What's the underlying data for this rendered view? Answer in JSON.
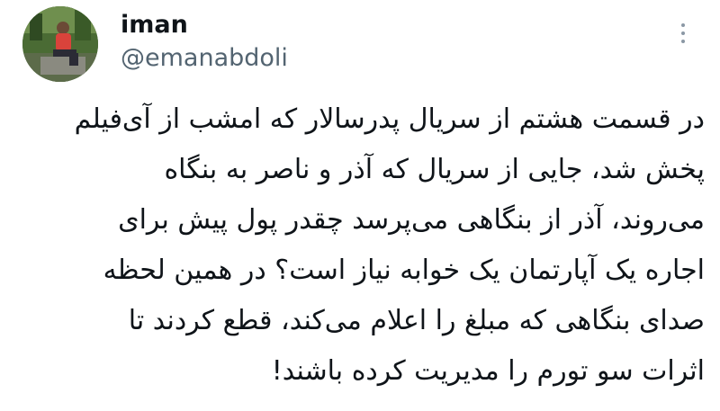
{
  "author": {
    "display_name": "iman",
    "handle": "@emanabdoli"
  },
  "icons": {
    "more": "more-options-icon",
    "avatar": "profile-photo"
  },
  "tweet": {
    "lines": [
      "در قسمت هشتم از سریال پدرسالار که امشب از آی‌فیلم",
      "پخش شد، جایی از سریال که آذر و ناصر  به بنگاه",
      "می‌روند، آذر از بنگاهی می‌پرسد چقدر پول پیش برای",
      "اجاره یک آپارتمان یک خوابه نیاز است؟ در همین لحظه",
      "صدای بنگاهی که مبلغ را اعلام می‌کند، قطع کردند تا",
      "اثرات سو تورم را مدیریت کرده باشند!"
    ]
  },
  "colors": {
    "text": "#0f1419",
    "secondary": "#536471",
    "icon": "#8b98a5",
    "background": "#ffffff"
  }
}
